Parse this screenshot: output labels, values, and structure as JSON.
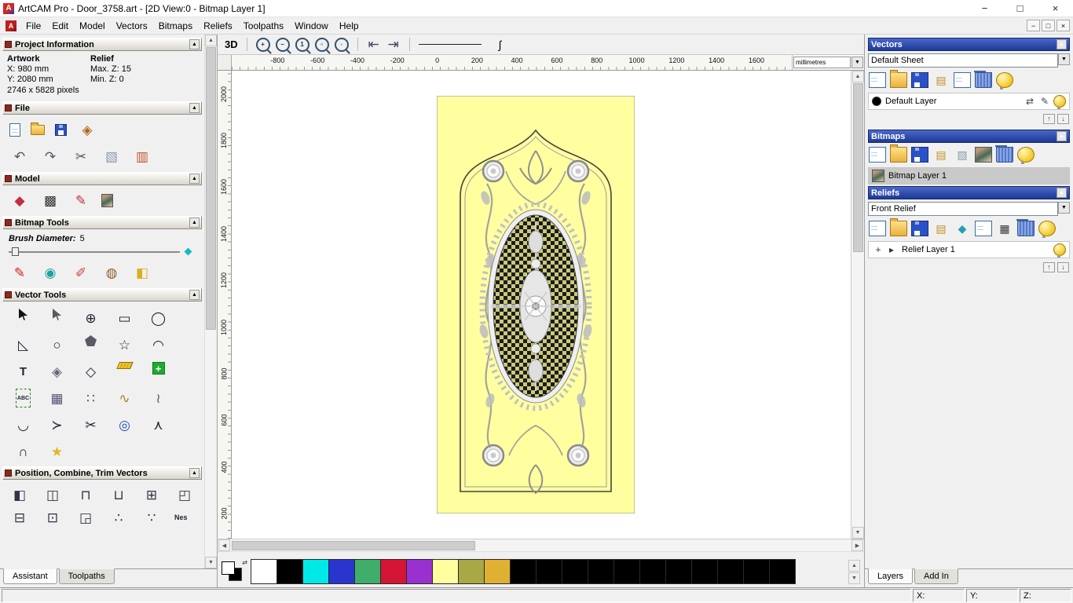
{
  "titlebar": {
    "icon_letter": "A",
    "title": "ArtCAM Pro - Door_3758.art - [2D View:0 - Bitmap Layer 1]",
    "minimize": "−",
    "maximize": "□",
    "close": "×"
  },
  "menubar": {
    "doc_icon_letter": "A",
    "items": [
      "File",
      "Edit",
      "Model",
      "Vectors",
      "Bitmaps",
      "Reliefs",
      "Toolpaths",
      "Window",
      "Help"
    ],
    "mdi_minimize": "−",
    "mdi_restore": "□",
    "mdi_close": "×"
  },
  "assistant": {
    "tabs": [
      {
        "label": "Assistant"
      },
      {
        "label": "Toolpaths"
      }
    ],
    "project_info": {
      "title": "Project Information",
      "artwork_header": "Artwork",
      "relief_header": "Relief",
      "x_value": "X: 980 mm",
      "y_value": "Y: 2080 mm",
      "max_z": "Max. Z: 15",
      "min_z": "Min. Z: 0",
      "pixel_size": "2746 x 5828 pixels"
    },
    "file_section": {
      "title": "File",
      "icons_row1": [
        {
          "name": "new-model-icon",
          "kind": "page"
        },
        {
          "name": "open-model-icon",
          "kind": "folder"
        },
        {
          "name": "save-model-icon",
          "kind": "disk"
        },
        {
          "name": "import-3d-model-icon",
          "kind": "glyph",
          "glyph": "◈",
          "fg": "#b06a20"
        }
      ],
      "icons_row2": [
        {
          "name": "undo-icon",
          "kind": "glyph",
          "glyph": "↶",
          "fg": "#555566"
        },
        {
          "name": "redo-icon",
          "kind": "glyph",
          "glyph": "↷",
          "fg": "#555566"
        },
        {
          "name": "cut-icon",
          "kind": "glyph",
          "glyph": "✂",
          "fg": "#556"
        },
        {
          "name": "paste-icon",
          "kind": "glyph",
          "glyph": "▧",
          "fg": "#8899aa"
        },
        {
          "name": "notes-icon",
          "kind": "glyph",
          "glyph": "▥",
          "fg": "#c0522a"
        }
      ]
    },
    "model_section": {
      "title": "Model",
      "icons": [
        {
          "name": "greyscale-from-relief-icon",
          "kind": "glyph",
          "glyph": "◆",
          "fg": "#c03040"
        },
        {
          "name": "relief-from-image-icon",
          "kind": "glyph",
          "glyph": "▩",
          "fg": "#303030"
        },
        {
          "name": "sculpt-relief-icon",
          "kind": "glyph",
          "glyph": "✎",
          "fg": "#c03040"
        },
        {
          "name": "load-bitmap-icon",
          "kind": "img"
        }
      ]
    },
    "bitmap_tools": {
      "title": "Bitmap Tools",
      "brush_label": "Brush Diameter:",
      "brush_value": "5",
      "icons": [
        {
          "name": "draw-icon",
          "kind": "glyph",
          "glyph": "✎",
          "fg": "#cc2020"
        },
        {
          "name": "paint-icon",
          "kind": "glyph",
          "glyph": "◉",
          "fg": "#20a0a0"
        },
        {
          "name": "spray-icon",
          "kind": "glyph",
          "glyph": "✐",
          "fg": "#cc4040"
        },
        {
          "name": "colour-picker-icon",
          "kind": "glyph",
          "glyph": "◍",
          "fg": "#906030"
        },
        {
          "name": "flood-fill-icon",
          "kind": "glyph",
          "glyph": "◧",
          "fg": "#d8b020"
        }
      ]
    },
    "vector_tools": {
      "title": "Vector Tools",
      "icons": [
        {
          "name": "select-vectors-icon",
          "kind": "cursor"
        },
        {
          "name": "node-editing-icon",
          "kind": "cursor2"
        },
        {
          "name": "transform-vectors-icon",
          "kind": "glyph",
          "glyph": "⊕",
          "fg": "#223"
        },
        {
          "name": "create-rectangle-icon",
          "kind": "glyph",
          "glyph": "▭",
          "fg": "#223"
        },
        {
          "name": "create-circle-icon",
          "kind": "glyph",
          "glyph": "◯",
          "fg": "#223"
        },
        {
          "name": "create-polyline-icon",
          "kind": "glyph",
          "glyph": "◺",
          "fg": "#223"
        },
        {
          "name": "create-ellipse-icon",
          "kind": "glyph",
          "glyph": "○",
          "fg": "#223"
        },
        {
          "name": "create-polygon-icon",
          "kind": "pentagon"
        },
        {
          "name": "create-star-icon",
          "kind": "glyph",
          "glyph": "☆",
          "fg": "#223"
        },
        {
          "name": "create-arc-icon",
          "kind": "glyph",
          "glyph": "◠",
          "fg": "#223"
        },
        {
          "name": "create-text-icon",
          "kind": "text",
          "glyph": "T",
          "fg": "#223"
        },
        {
          "name": "wrap-text-icon",
          "kind": "glyph",
          "glyph": "◈",
          "fg": "#667"
        },
        {
          "name": "offset-vectors-icon",
          "kind": "glyph",
          "glyph": "◇",
          "fg": "#223"
        },
        {
          "name": "measure-icon",
          "kind": "ruler"
        },
        {
          "name": "paste-along-curve-icon",
          "kind": "plus",
          "glyph": "+"
        },
        {
          "name": "text-block-icon",
          "kind": "abc",
          "glyph": "ABC"
        },
        {
          "name": "paste-in-grid-icon",
          "kind": "glyph",
          "glyph": "▦",
          "fg": "#557"
        },
        {
          "name": "block-copy-icon",
          "kind": "glyph",
          "glyph": "∷",
          "fg": "#557"
        },
        {
          "name": "nest-vectors-icon",
          "kind": "glyph",
          "glyph": "∿",
          "fg": "#b08020"
        },
        {
          "name": "fit-curves-icon",
          "kind": "glyph",
          "glyph": "≀",
          "fg": "#557"
        },
        {
          "name": "join-vectors-icon",
          "kind": "glyph",
          "glyph": "◡",
          "fg": "#223"
        },
        {
          "name": "bridge-vectors-icon",
          "kind": "glyph",
          "glyph": "≻",
          "fg": "#223"
        },
        {
          "name": "trim-vectors-icon",
          "kind": "glyph",
          "glyph": "✂",
          "fg": "#223"
        },
        {
          "name": "extrude-vector-icon",
          "kind": "glyph",
          "glyph": "◎",
          "fg": "#2050c0"
        },
        {
          "name": "slice-vectors-icon",
          "kind": "glyph",
          "glyph": "⋏",
          "fg": "#223"
        },
        {
          "name": "arc-fit-icon",
          "kind": "glyph",
          "glyph": "∩",
          "fg": "#223"
        },
        {
          "name": "wand-vectors-icon",
          "kind": "glyph",
          "glyph": "★",
          "fg": "#e0b820"
        }
      ]
    },
    "position_section": {
      "title": "Position, Combine, Trim Vectors",
      "icons_row1": [
        {
          "name": "align-left-icon",
          "kind": "glyph",
          "glyph": "◧",
          "fg": "#334"
        },
        {
          "name": "align-centre-icon",
          "kind": "glyph",
          "glyph": "◫",
          "fg": "#334"
        },
        {
          "name": "align-top-icon",
          "kind": "glyph",
          "glyph": "⊓",
          "fg": "#334"
        },
        {
          "name": "align-bottom-icon",
          "kind": "glyph",
          "glyph": "⊔",
          "fg": "#334"
        },
        {
          "name": "centre-in-page-icon",
          "kind": "glyph",
          "glyph": "⊞",
          "fg": "#334"
        },
        {
          "name": "align-inside-icon",
          "kind": "glyph",
          "glyph": "◰",
          "fg": "#334"
        }
      ],
      "icons_row2": [
        {
          "name": "weld-vectors-icon",
          "kind": "glyph",
          "glyph": "⊟",
          "fg": "#334"
        },
        {
          "name": "subtract-vectors-icon",
          "kind": "glyph",
          "glyph": "⊡",
          "fg": "#334"
        },
        {
          "name": "trim-overlap-icon",
          "kind": "glyph",
          "glyph": "◲",
          "fg": "#334"
        },
        {
          "name": "scatter-copies-icon",
          "kind": "glyph",
          "glyph": "∴",
          "fg": "#334"
        },
        {
          "name": "array-copy-icon",
          "kind": "glyph",
          "glyph": "∵",
          "fg": "#334"
        },
        {
          "name": "nesting-icon",
          "kind": "text-sm",
          "glyph": "Nes",
          "fg": "#223"
        }
      ]
    }
  },
  "view": {
    "toolbar": {
      "view3d_label": "3D",
      "icons": [
        {
          "name": "zoom-in-icon",
          "kind": "mag",
          "glyph": "+"
        },
        {
          "name": "zoom-out-icon",
          "kind": "mag",
          "glyph": "−"
        },
        {
          "name": "zoom-1to1-icon",
          "kind": "mag",
          "glyph": "1"
        },
        {
          "name": "zoom-box-icon",
          "kind": "mag",
          "glyph": "▫"
        },
        {
          "name": "zoom-fit-icon",
          "kind": "mag",
          "glyph": "◦"
        },
        {
          "kind": "sep"
        },
        {
          "name": "previous-bitmap-layer-icon",
          "kind": "glyph",
          "glyph": "⇤",
          "fg": "#446"
        },
        {
          "name": "next-bitmap-layer-icon",
          "kind": "glyph",
          "glyph": "⇥",
          "fg": "#446"
        },
        {
          "kind": "sep"
        }
      ],
      "curve_glyph": "∫"
    },
    "ruler": {
      "h_ticks": [
        "-800",
        "-600",
        "-400",
        "-200",
        "0",
        "200",
        "400",
        "600",
        "800",
        "1000",
        "1200",
        "1400",
        "1600"
      ],
      "v_ticks": [
        "2000",
        "1800",
        "1600",
        "1400",
        "1200",
        "1000",
        "800",
        "600",
        "400",
        "200"
      ],
      "units": "millimetres"
    },
    "door_color": "#ffffa0",
    "palette": {
      "colors": [
        "#ffffff",
        "#000000",
        "#00e8e8",
        "#2a35cf",
        "#3fae6a",
        "#d51535",
        "#9a30cf",
        "#ffffa0",
        "#a8a845",
        "#e0b032",
        "#000000",
        "#000000",
        "#000000",
        "#000000",
        "#000000",
        "#000000",
        "#000000",
        "#000000",
        "#000000",
        "#000000",
        "#000000"
      ]
    }
  },
  "layers_panel": {
    "tabs": [
      {
        "label": "Layers"
      },
      {
        "label": "Add In"
      }
    ],
    "vectors": {
      "title": "Vectors",
      "sheet_value": "Default Sheet",
      "icons": [
        {
          "name": "new-vector-layer-icon",
          "kind": "page"
        },
        {
          "name": "open-vectors-icon",
          "kind": "folder"
        },
        {
          "name": "save-vectors-icon",
          "kind": "disk"
        },
        {
          "name": "import-vectors-icon",
          "kind": "glyph",
          "glyph": "▤",
          "fg": "#c09020"
        },
        {
          "name": "new-sheet-icon",
          "kind": "page"
        },
        {
          "name": "delete-vector-layer-icon",
          "kind": "trash"
        },
        {
          "name": "all-layers-visibility-icon",
          "kind": "bulb"
        }
      ],
      "layer_name": "Default Layer",
      "layer_color": "#000000",
      "layer_icons": [
        {
          "name": "snap-layer-icon",
          "kind": "glyph",
          "glyph": "⇄",
          "fg": "#445"
        },
        {
          "name": "edit-layer-colour-icon",
          "kind": "glyph",
          "glyph": "✎",
          "fg": "#445"
        },
        {
          "name": "layer-visibility-icon",
          "kind": "bulb"
        }
      ],
      "updown": [
        {
          "name": "move-layer-up-icon",
          "kind": "sbtn",
          "glyph": "↑",
          "fg": "#2040c0"
        },
        {
          "name": "move-layer-down-icon",
          "kind": "sbtn",
          "glyph": "↓",
          "fg": "#2040c0"
        }
      ]
    },
    "bitmaps": {
      "title": "Bitmaps",
      "icons": [
        {
          "name": "new-bitmap-layer-icon",
          "kind": "page"
        },
        {
          "name": "open-bitmap-icon",
          "kind": "folder"
        },
        {
          "name": "save-bitmap-icon",
          "kind": "disk"
        },
        {
          "name": "import-bitmap-icon",
          "kind": "glyph",
          "glyph": "▤",
          "fg": "#c09020"
        },
        {
          "name": "copy-bitmap-icon",
          "kind": "glyph",
          "glyph": "▧",
          "fg": "#8899aa"
        },
        {
          "name": "bitmap-preview-icon",
          "kind": "img"
        },
        {
          "name": "delete-bitmap-layer-icon",
          "kind": "trash"
        },
        {
          "name": "bitmap-visibility-icon",
          "kind": "bulb"
        }
      ],
      "layer_icons_left": [
        {
          "name": "bitmap-layer-thumb-icon",
          "kind": "img"
        }
      ],
      "layer_name": "Bitmap Layer 1"
    },
    "reliefs": {
      "title": "Reliefs",
      "relief_value": "Front Relief",
      "icons": [
        {
          "name": "new-relief-layer-icon",
          "kind": "page"
        },
        {
          "name": "open-relief-icon",
          "kind": "folder"
        },
        {
          "name": "save-relief-icon",
          "kind": "disk"
        },
        {
          "name": "import-relief-icon",
          "kind": "glyph",
          "glyph": "▤",
          "fg": "#c09020"
        },
        {
          "name": "smooth-relief-icon",
          "kind": "glyph",
          "glyph": "◆",
          "fg": "#20a0b0"
        },
        {
          "name": "copy-relief-icon",
          "kind": "page"
        },
        {
          "name": "texture-relief-icon",
          "kind": "glyph",
          "glyph": "▦",
          "fg": "#333"
        },
        {
          "name": "delete-relief-layer-icon",
          "kind": "trash"
        },
        {
          "name": "relief-visibility-icon",
          "kind": "bulb"
        }
      ],
      "layer_icons_left": [
        {
          "name": "add-relief-layer-icon",
          "kind": "glyph",
          "glyph": "+",
          "fg": "#333"
        },
        {
          "name": "expand-relief-layer-icon",
          "kind": "glyph",
          "glyph": "▸",
          "fg": "#333"
        }
      ],
      "layer_name": "Relief Layer 1",
      "layer_icons": [
        {
          "name": "relief-layer-visibility-icon",
          "kind": "bulb"
        }
      ],
      "updown": [
        {
          "name": "move-relief-up-icon",
          "kind": "sbtn",
          "glyph": "↑",
          "fg": "#2040c0"
        },
        {
          "name": "move-relief-down-icon",
          "kind": "sbtn",
          "glyph": "↓",
          "fg": "#2040c0"
        }
      ]
    }
  },
  "statusbar": {
    "x_label": "X:",
    "y_label": "Y:",
    "z_label": "Z:"
  }
}
